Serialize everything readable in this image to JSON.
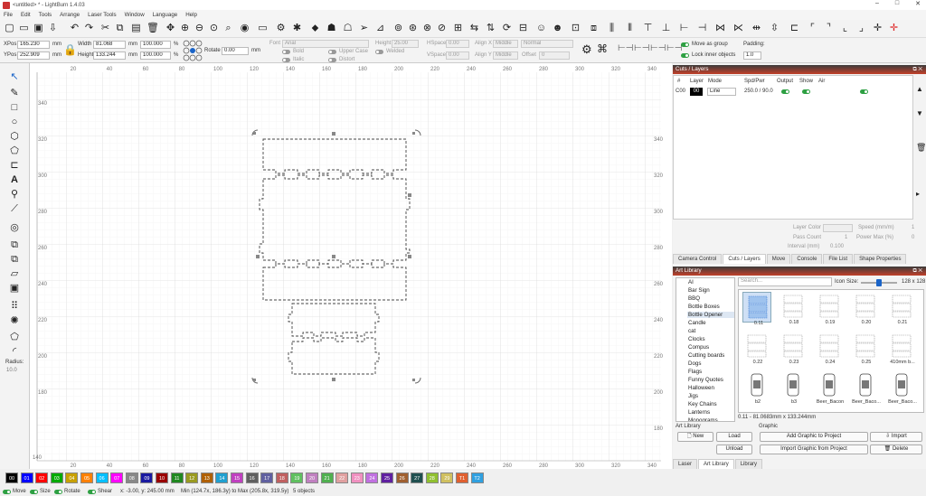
{
  "window": {
    "title": "<untitled> * - LightBurn 1.4.03",
    "controls": [
      "–",
      "□",
      "✕"
    ]
  },
  "menu": [
    "File",
    "Edit",
    "Tools",
    "Arrange",
    "Laser Tools",
    "Window",
    "Language",
    "Help"
  ],
  "toolbar_icons": [
    "new-file-icon",
    "open-file-icon",
    "save-icon",
    "import-icon",
    "export-icon",
    "undo-icon",
    "redo-icon",
    "cut-icon",
    "copy-icon",
    "paste-icon",
    "delete-icon",
    "move-icon",
    "zoom-in-icon",
    "zoom-out-icon",
    "zoom-fit-icon",
    "zoom-window-icon",
    "camera-icon",
    "monitor-icon",
    "settings-icon",
    "tools-icon",
    "node-icon",
    "trace-icon",
    "offset-icon",
    "user-icon",
    "user2-icon",
    "send-icon",
    "align-icon",
    "group-icon",
    "ungroup-icon",
    "boolean-icon",
    "weld-icon",
    "center-icon",
    "flip-h-icon",
    "flip-v-icon",
    "rotate-icon",
    "distribute-icon",
    "array-icon",
    "mirror-icon",
    "nest-icon",
    "crosshair-icon"
  ],
  "transform": {
    "xpos_label": "XPos",
    "xpos": "165.230",
    "ypos_label": "YPos",
    "ypos": "252.909",
    "unit": "mm",
    "width_label": "Width",
    "width": "81.068",
    "height_label": "Height",
    "height": "133.244",
    "scale_w": "100.000",
    "scale_h": "100.000",
    "pct": "%",
    "rotate_label": "Rotate",
    "rotate": "0.00",
    "rotate_unit": "mm"
  },
  "text_tools": {
    "font_label": "Font",
    "font": "Arial",
    "height_label": "Height",
    "height": "25.00",
    "hspace_label": "HSpace",
    "hspace": "0.00",
    "vspace_label": "VSpace",
    "vspace": "0.00",
    "alignx_label": "Align X",
    "alignx": "Middle",
    "aligny_label": "Align Y",
    "aligny": "Middle",
    "style": "Normal",
    "offset_label": "Offset",
    "offset": "0",
    "bold": "Bold",
    "italic": "Italic",
    "upper": "Upper Case",
    "distort": "Distort",
    "welded": "Welded"
  },
  "group_opts": {
    "move_as_group": "Move as group",
    "lock_inner": "Lock inner objects",
    "padding_label": "Padding:",
    "padding": "1.0"
  },
  "left_tools": [
    "select-icon",
    "pen-icon",
    "rectangle-icon",
    "ellipse-icon",
    "polygon-icon",
    "star-icon",
    "tab-icon",
    "text-icon",
    "pin-icon",
    "measure-icon",
    "offset-circle-icon",
    "copy-along-icon",
    "duplicate-icon",
    "group-icon",
    "layers-icon",
    "array-grid-icon",
    "circular-array-icon",
    "bevel-icon",
    "corner-icon"
  ],
  "radius": {
    "label": "Radius:",
    "value": "10.0"
  },
  "canvas": {
    "top_ruler": [
      "20",
      "40",
      "60",
      "80",
      "100",
      "120",
      "140",
      "160",
      "180",
      "200",
      "220",
      "240",
      "260",
      "280",
      "300",
      "320",
      "340",
      "360",
      "380"
    ],
    "left_ruler": [
      "340",
      "320",
      "300",
      "280",
      "260",
      "240",
      "220",
      "200",
      "180"
    ],
    "right_ruler": [
      "340",
      "320",
      "300",
      "280",
      "260",
      "240",
      "220",
      "200",
      "180"
    ],
    "bottom_ruler": [
      "20",
      "40",
      "60",
      "80",
      "100",
      "120",
      "140",
      "160",
      "180",
      "200",
      "220",
      "240",
      "260",
      "280",
      "300",
      "320",
      "340",
      "360",
      "380"
    ],
    "corner_label": "140"
  },
  "cuts": {
    "title": "Cuts / Layers",
    "headers": [
      "#",
      "Layer",
      "Mode",
      "Spd/Pwr",
      "Output",
      "Show",
      "Air"
    ],
    "rows": [
      {
        "num": "C00",
        "layer": "00",
        "mode": "Line",
        "spdpwr": "250.0 / 90.0"
      }
    ],
    "layer_color_label": "Layer Color",
    "speed_label": "Speed (mm/m)",
    "speed": "1",
    "pass_label": "Pass Count",
    "pass": "1",
    "powermax_label": "Power Max (%)",
    "powermax": "0",
    "interval_label": "Interval (mm)",
    "interval": "0.100"
  },
  "panel_tabs": [
    "Camera Control",
    "Cuts / Layers",
    "Move",
    "Console",
    "File List",
    "Shape Properties"
  ],
  "art_library": {
    "title": "Art Library",
    "search_placeholder": "Search...",
    "icon_size_label": "Icon Size:",
    "icon_size": "128 x 128",
    "categories": [
      "AI",
      "Bar Sign",
      "BBQ",
      "Bottle Boxes",
      "Bottle Opener",
      "Candle",
      "cat",
      "Clocks",
      "Compus",
      "Cutting boards",
      "Dogs",
      "Flags",
      "Funny Quotes",
      "Halloween",
      "Jigs",
      "Key Chains",
      "Lanterns",
      "Monograms"
    ],
    "selected": "Bottle Opener",
    "thumbs": [
      "0.11",
      "0.18",
      "0.19",
      "0.20",
      "0.21",
      "0.22",
      "0.23",
      "0.24",
      "0.25",
      "410mm b...",
      "b2",
      "b3",
      "Beer_Bacon",
      "Beer_Baco...",
      "Beer_Baco..."
    ],
    "info": "0.11 - 81.0683mm x 133.244mm",
    "art_label": "Art Library",
    "graphic_label": "Graphic",
    "btn_new": "New",
    "btn_load": "Load",
    "btn_unload": "Unload",
    "btn_add": "Add Graphic to Project",
    "btn_import_from": "Import Graphic from Project",
    "btn_import": "Import",
    "btn_delete": "Delete"
  },
  "bottom_tabs": [
    "Laser",
    "Art Library",
    "Library"
  ],
  "palette": [
    {
      "id": "00",
      "c": "#000000"
    },
    {
      "id": "01",
      "c": "#0000ff"
    },
    {
      "id": "02",
      "c": "#ff0000"
    },
    {
      "id": "03",
      "c": "#00aa00"
    },
    {
      "id": "04",
      "c": "#c8a000"
    },
    {
      "id": "05",
      "c": "#ff8000"
    },
    {
      "id": "06",
      "c": "#00bfff"
    },
    {
      "id": "07",
      "c": "#ff00ff"
    },
    {
      "id": "08",
      "c": "#888888"
    },
    {
      "id": "09",
      "c": "#1a1aa0"
    },
    {
      "id": "10",
      "c": "#9a0000"
    },
    {
      "id": "11",
      "c": "#208820"
    },
    {
      "id": "12",
      "c": "#9a9a20"
    },
    {
      "id": "13",
      "c": "#b06000"
    },
    {
      "id": "14",
      "c": "#20a0d0"
    },
    {
      "id": "15",
      "c": "#c040c0"
    },
    {
      "id": "16",
      "c": "#606060"
    },
    {
      "id": "17",
      "c": "#6060a0"
    },
    {
      "id": "18",
      "c": "#c06060"
    },
    {
      "id": "19",
      "c": "#60c060"
    },
    {
      "id": "20",
      "c": "#c080c0"
    },
    {
      "id": "21",
      "c": "#50b050"
    },
    {
      "id": "22",
      "c": "#e0a0a0"
    },
    {
      "id": "23",
      "c": "#f090c0"
    },
    {
      "id": "24",
      "c": "#c070e0"
    },
    {
      "id": "25",
      "c": "#6020a0"
    },
    {
      "id": "26",
      "c": "#a06030"
    },
    {
      "id": "27",
      "c": "#205050"
    },
    {
      "id": "28",
      "c": "#90c030"
    },
    {
      "id": "29",
      "c": "#d0c060"
    },
    {
      "id": "T1",
      "c": "#e06030"
    },
    {
      "id": "T2",
      "c": "#30a0e0"
    }
  ],
  "status": {
    "move": "Move",
    "size": "Size",
    "rotate": "Rotate",
    "shear": "Shear",
    "coords": "x: -3.00, y: 245.00 mm",
    "range": "Min (124.7x, 186.3y) to Max (205.8x, 319.5y)",
    "objects": "5 objects"
  }
}
